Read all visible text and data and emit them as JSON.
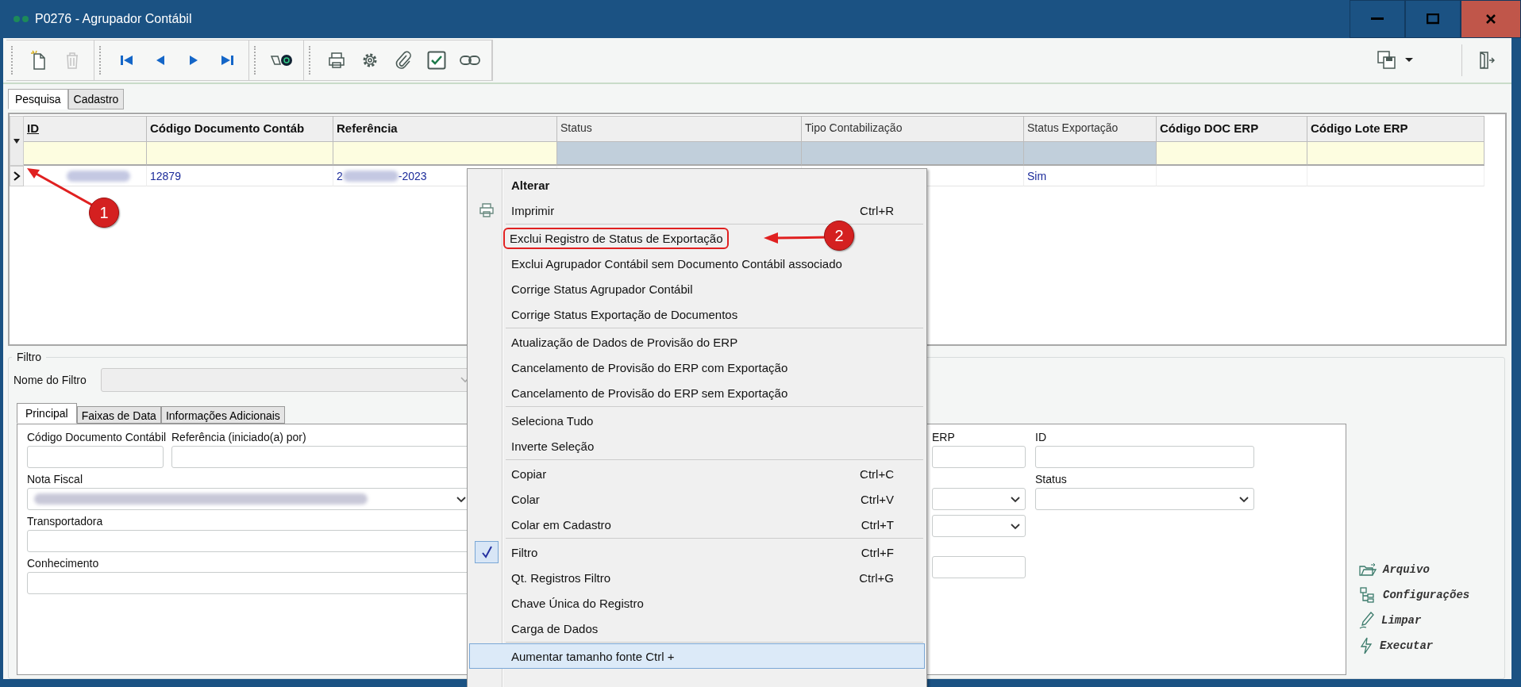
{
  "window": {
    "title": "P0276 - Agrupador Contábil"
  },
  "toolbar": {
    "groups": [
      [
        {
          "kind": "new",
          "disabled": false
        },
        {
          "kind": "delete",
          "disabled": true
        }
      ],
      [
        {
          "kind": "first",
          "disabled": false
        },
        {
          "kind": "prev",
          "disabled": false
        },
        {
          "kind": "next",
          "disabled": false
        },
        {
          "kind": "last",
          "disabled": false
        }
      ],
      [
        {
          "kind": "find",
          "disabled": false
        }
      ],
      [
        {
          "kind": "print",
          "disabled": false
        },
        {
          "kind": "settings",
          "disabled": false
        },
        {
          "kind": "attach",
          "disabled": false
        },
        {
          "kind": "check",
          "disabled": false
        },
        {
          "kind": "link",
          "disabled": false
        }
      ]
    ],
    "right": [
      {
        "kind": "save-menu"
      },
      {
        "kind": "exit"
      }
    ]
  },
  "page_tabs": [
    {
      "label": "Pesquisa",
      "selected": true
    },
    {
      "label": "Cadastro",
      "selected": false
    }
  ],
  "grid": {
    "columns": [
      {
        "label": "ID",
        "bold": true,
        "sorted": true,
        "filter_editable": true
      },
      {
        "label": "Código Documento Contáb",
        "bold": true,
        "sorted": false,
        "filter_editable": true
      },
      {
        "label": "Referência",
        "bold": true,
        "sorted": false,
        "filter_editable": true
      },
      {
        "label": "Status",
        "bold": false,
        "sorted": false,
        "filter_editable": false
      },
      {
        "label": "Tipo Contabilização",
        "bold": false,
        "sorted": false,
        "filter_editable": false
      },
      {
        "label": "Status Exportação",
        "bold": false,
        "sorted": false,
        "filter_editable": false
      },
      {
        "label": "Código DOC ERP",
        "bold": true,
        "sorted": false,
        "filter_editable": true
      },
      {
        "label": "Código Lote ERP",
        "bold": true,
        "sorted": false,
        "filter_editable": true
      }
    ],
    "rows": [
      {
        "current": true,
        "cells": [
          {
            "kind": "redacted"
          },
          {
            "kind": "text",
            "text": "12879"
          },
          {
            "kind": "partly-redacted",
            "start": "2",
            "end": "-2023"
          },
          {
            "kind": "empty"
          },
          {
            "kind": "empty"
          },
          {
            "kind": "text",
            "text": "Sim"
          },
          {
            "kind": "empty"
          },
          {
            "kind": "empty"
          }
        ]
      }
    ]
  },
  "context_menu": {
    "items": [
      {
        "kind": "item",
        "label": "Alterar",
        "bold": true,
        "has_icon": false,
        "checked": false,
        "highlighted": false,
        "marked": false
      },
      {
        "kind": "item",
        "label": "Imprimir",
        "shortcut": "Ctrl+R",
        "bold": false,
        "has_icon": true,
        "checked": false,
        "highlighted": false,
        "marked": false
      },
      {
        "kind": "separator"
      },
      {
        "kind": "item",
        "label": "Exclui Registro de Status de Exportação",
        "bold": false,
        "has_icon": false,
        "checked": false,
        "highlighted": false,
        "marked": true
      },
      {
        "kind": "item",
        "label": "Exclui Agrupador Contábil sem Documento Contábil associado",
        "bold": false,
        "has_icon": false,
        "checked": false,
        "highlighted": false,
        "marked": false
      },
      {
        "kind": "item",
        "label": "Corrige Status Agrupador Contábil",
        "bold": false,
        "has_icon": false,
        "checked": false,
        "highlighted": false,
        "marked": false
      },
      {
        "kind": "item",
        "label": "Corrige Status Exportação de Documentos",
        "bold": false,
        "has_icon": false,
        "checked": false,
        "highlighted": false,
        "marked": false
      },
      {
        "kind": "separator"
      },
      {
        "kind": "item",
        "label": "Atualização de Dados de Provisão do ERP",
        "bold": false,
        "has_icon": false,
        "checked": false,
        "highlighted": false,
        "marked": false
      },
      {
        "kind": "item",
        "label": "Cancelamento de Provisão do ERP com Exportação",
        "bold": false,
        "has_icon": false,
        "checked": false,
        "highlighted": false,
        "marked": false
      },
      {
        "kind": "item",
        "label": "Cancelamento de Provisão do ERP sem Exportação",
        "bold": false,
        "has_icon": false,
        "checked": false,
        "highlighted": false,
        "marked": false
      },
      {
        "kind": "separator"
      },
      {
        "kind": "item",
        "label": "Seleciona Tudo",
        "bold": false,
        "has_icon": false,
        "checked": false,
        "highlighted": false,
        "marked": false
      },
      {
        "kind": "item",
        "label": "Inverte Seleção",
        "bold": false,
        "has_icon": false,
        "checked": false,
        "highlighted": false,
        "marked": false
      },
      {
        "kind": "separator"
      },
      {
        "kind": "item",
        "label": "Copiar",
        "shortcut": "Ctrl+C",
        "bold": false,
        "has_icon": false,
        "checked": false,
        "highlighted": false,
        "marked": false
      },
      {
        "kind": "item",
        "label": "Colar",
        "shortcut": "Ctrl+V",
        "bold": false,
        "has_icon": false,
        "checked": false,
        "highlighted": false,
        "marked": false
      },
      {
        "kind": "item",
        "label": "Colar em Cadastro",
        "shortcut": "Ctrl+T",
        "bold": false,
        "has_icon": false,
        "checked": false,
        "highlighted": false,
        "marked": false
      },
      {
        "kind": "separator"
      },
      {
        "kind": "item",
        "label": "Filtro",
        "shortcut": "Ctrl+F",
        "bold": false,
        "has_icon": false,
        "checked": true,
        "highlighted": false,
        "marked": false
      },
      {
        "kind": "item",
        "label": "Qt. Registros Filtro",
        "shortcut": "Ctrl+G",
        "bold": false,
        "has_icon": false,
        "checked": false,
        "highlighted": false,
        "marked": false
      },
      {
        "kind": "item",
        "label": "Chave Única do Registro",
        "bold": false,
        "has_icon": false,
        "checked": false,
        "highlighted": false,
        "marked": false
      },
      {
        "kind": "item",
        "label": "Carga de Dados",
        "bold": false,
        "has_icon": false,
        "checked": false,
        "highlighted": false,
        "marked": false
      },
      {
        "kind": "separator"
      },
      {
        "kind": "item",
        "label": "Aumentar tamanho fonte  Ctrl +",
        "bold": false,
        "has_icon": false,
        "checked": false,
        "highlighted": true,
        "marked": false
      }
    ]
  },
  "filter": {
    "legend": "Filtro",
    "name_label": "Nome do Filtro",
    "name_disabled": true,
    "tabs": [
      {
        "label": "Principal",
        "selected": true
      },
      {
        "label": "Faixas de Data",
        "selected": false
      },
      {
        "label": "Informações Adicionais",
        "selected": false
      }
    ],
    "left": {
      "codigo": {
        "label": "Código Documento Contábil",
        "kind": "text"
      },
      "referencia": {
        "label": "Referência (iniciado(a) por)",
        "kind": "text"
      },
      "nota_fiscal": {
        "label": "Nota Fiscal",
        "kind": "redacted-combo"
      },
      "transportadora": {
        "label": "Transportadora",
        "kind": "text"
      },
      "conhecimento": {
        "label": "Conhecimento",
        "kind": "text"
      }
    },
    "right": {
      "erp": {
        "label": "ERP",
        "kind": "text"
      },
      "id": {
        "label": "ID",
        "kind": "text"
      },
      "field_3": {
        "kind": "combo"
      },
      "status": {
        "label": "Status",
        "kind": "combo"
      },
      "field_5": {
        "kind": "combo"
      },
      "field_6": {
        "kind": "text"
      }
    },
    "actions": [
      {
        "kind": "file",
        "label": "Arquivo"
      },
      {
        "kind": "config",
        "label": "Configurações"
      },
      {
        "kind": "clear",
        "label": "Limpar"
      },
      {
        "kind": "run",
        "label": "Executar"
      }
    ]
  },
  "annotations": [
    {
      "label": "1"
    },
    {
      "label": "2"
    }
  ]
}
